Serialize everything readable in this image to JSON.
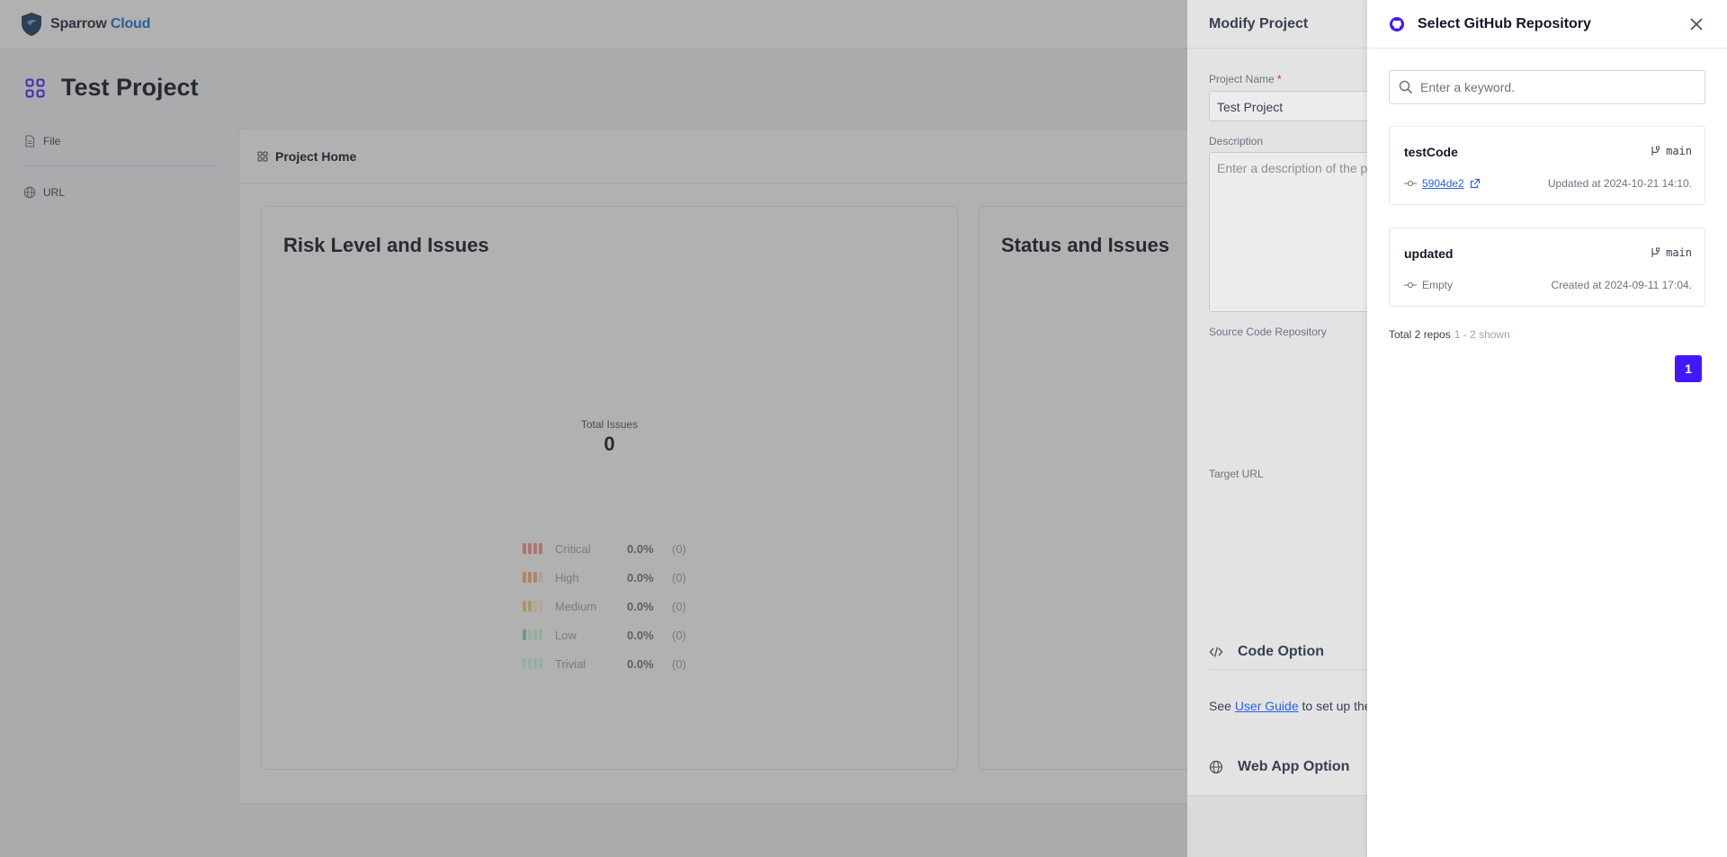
{
  "brand": {
    "name_part1": "Sparrow",
    "name_part2": "Cloud"
  },
  "page": {
    "title": "Test Project"
  },
  "side_nav": {
    "items": [
      {
        "label": "File"
      },
      {
        "label": "URL"
      }
    ]
  },
  "home": {
    "tab_label": "Project Home",
    "risk_card": {
      "title": "Risk Level and Issues",
      "total_label": "Total Issues",
      "total_value": "0",
      "levels": [
        {
          "name": "Critical",
          "pct": "0.0%",
          "count": "(0)",
          "color": "#ef4444"
        },
        {
          "name": "High",
          "pct": "0.0%",
          "count": "(0)",
          "color": "#f97316"
        },
        {
          "name": "Medium",
          "pct": "0.0%",
          "count": "(0)",
          "color": "#eab308"
        },
        {
          "name": "Low",
          "pct": "0.0%",
          "count": "(0)",
          "color": "#22c55e"
        },
        {
          "name": "Trivial",
          "pct": "0.0%",
          "count": "(0)",
          "color": "#2dd4bf"
        }
      ]
    },
    "status_card": {
      "title": "Status and Issues"
    }
  },
  "modify": {
    "title": "Modify Project",
    "name_label": "Project Name",
    "required_mark": "*",
    "name_value": "Test Project",
    "description_label": "Description",
    "description_placeholder": "Enter a description of the p",
    "source_label": "Source Code Repository",
    "target_label": "Target URL",
    "code_option_title": "Code Option",
    "guide_prefix": "See ",
    "guide_link": "User Guide",
    "guide_suffix": " to set up the",
    "web_option_title": "Web App Option"
  },
  "github": {
    "title": "Select GitHub Repository",
    "search_placeholder": "Enter a keyword.",
    "repos": [
      {
        "name": "testCode",
        "branch": "main",
        "commit": "5904de2",
        "date": "Updated at 2024-10-21 14:10."
      },
      {
        "name": "updated",
        "branch": "main",
        "commit": "Empty",
        "date": "Created at 2024-09-11 17:04."
      }
    ],
    "total": "Total 2 repos",
    "shown": "1 - 2 shown",
    "current_page": "1",
    "accent": "#4318ff"
  }
}
